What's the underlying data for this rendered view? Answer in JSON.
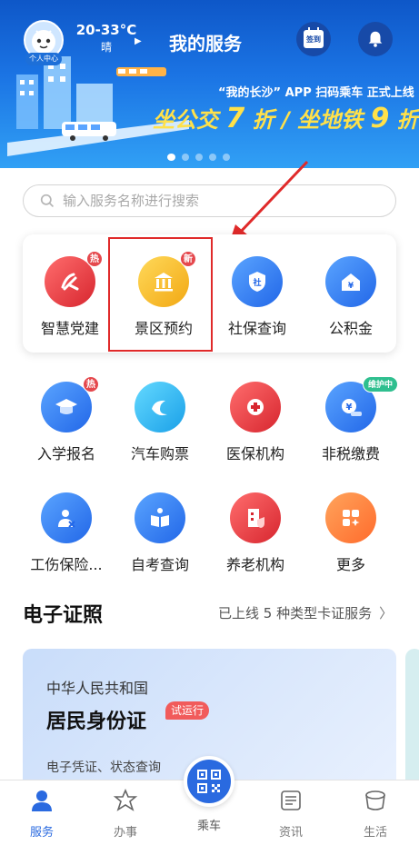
{
  "header": {
    "avatar_label": "个人中心",
    "weather_temp": "20-33°C",
    "weather_condition": "晴",
    "title": "我的服务",
    "calendar_label": "签到"
  },
  "banner": {
    "promo_line": "“我的长沙” APP 扫码乘车 正式上线",
    "promo_bus": "坐公交",
    "promo_bus_discount": "7",
    "promo_metro": "折 / 坐地铁",
    "promo_metro_discount": "9",
    "promo_suffix": "折",
    "slides": 5,
    "active_slide": 0
  },
  "search": {
    "placeholder": "输入服务名称进行搜索"
  },
  "featured": [
    {
      "label": "智慧党建",
      "icon": "party-emblem-icon",
      "badge": "热"
    },
    {
      "label": "景区预约",
      "icon": "museum-icon",
      "badge": "新"
    },
    {
      "label": "社保查询",
      "icon": "shield-icon",
      "glyph": "社"
    },
    {
      "label": "公积金",
      "icon": "house-icon",
      "glyph": "¥"
    }
  ],
  "services": [
    {
      "label": "入学报名",
      "icon": "graduation-cap-icon",
      "badge": "热"
    },
    {
      "label": "汽车购票",
      "icon": "bus-ticket-icon"
    },
    {
      "label": "医保机构",
      "icon": "medical-cross-icon"
    },
    {
      "label": "非税缴费",
      "icon": "payment-icon",
      "badge": "维护中",
      "glyph": "¥"
    },
    {
      "label": "工伤保险...",
      "icon": "injury-insurance-icon"
    },
    {
      "label": "自考查询",
      "icon": "book-icon"
    },
    {
      "label": "养老机构",
      "icon": "building-icon"
    },
    {
      "label": "更多",
      "icon": "more-grid-icon"
    }
  ],
  "e_license": {
    "title": "电子证照",
    "link": "已上线 5 种类型卡证服务",
    "card": {
      "country": "中华人民共和国",
      "name": "居民身份证",
      "tag": "试运行",
      "subtitle": "电子凭证、状态查询"
    }
  },
  "tabbar": {
    "tabs": [
      {
        "label": "服务",
        "icon": "person-icon",
        "active": true
      },
      {
        "label": "办事",
        "icon": "star-tent-icon",
        "active": false
      },
      {
        "label": "乘车",
        "icon": "qr-code-icon",
        "active": false
      },
      {
        "label": "资讯",
        "icon": "news-icon",
        "active": false
      },
      {
        "label": "生活",
        "icon": "cup-icon",
        "active": false
      }
    ]
  },
  "colors": {
    "brand_blue": "#2a6ae0",
    "banner_top": "#0e57c8",
    "promo_yellow": "#ffe14a",
    "badge_red": "#e5484d",
    "annotation_red": "#e02a2a"
  }
}
